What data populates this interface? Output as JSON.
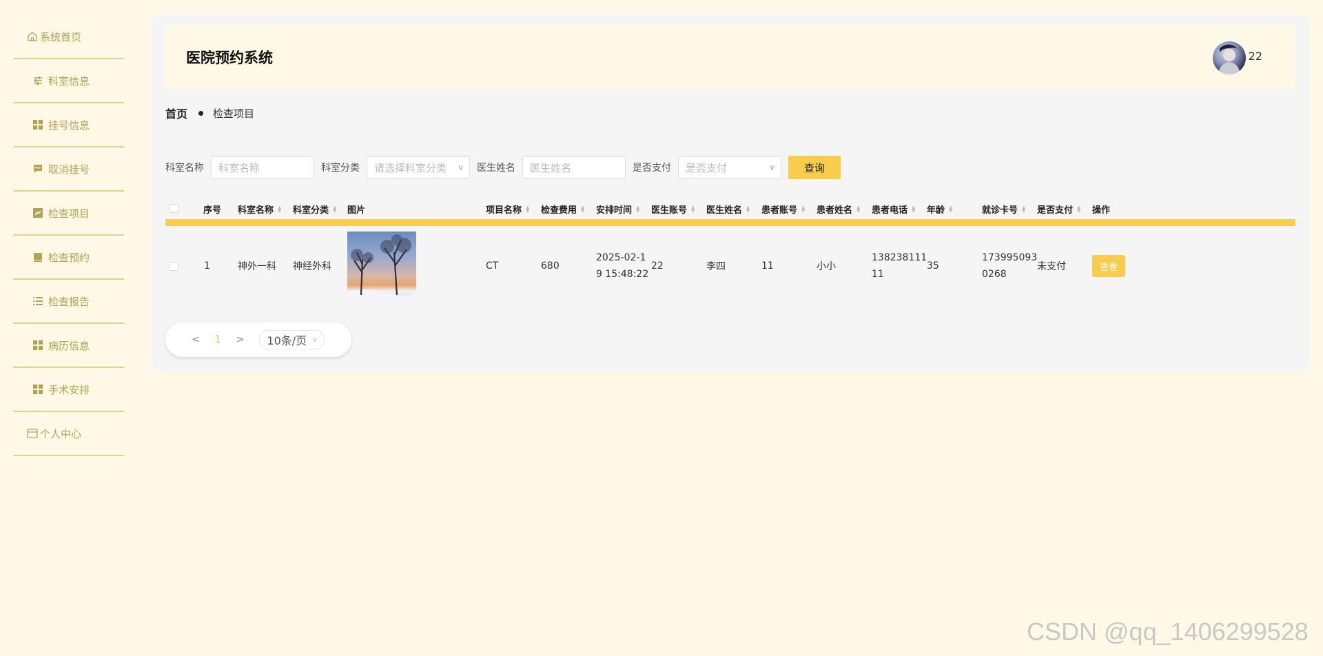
{
  "sidebar": {
    "items": [
      {
        "label": "系统首页",
        "icon": "home-icon"
      },
      {
        "label": "科室信息",
        "icon": "sliders-icon"
      },
      {
        "label": "挂号信息",
        "icon": "grid-icon"
      },
      {
        "label": "取消挂号",
        "icon": "message-icon"
      },
      {
        "label": "检查项目",
        "icon": "chart-icon"
      },
      {
        "label": "检查预约",
        "icon": "calendar-icon"
      },
      {
        "label": "检查报告",
        "icon": "list-icon"
      },
      {
        "label": "病历信息",
        "icon": "grid-icon"
      },
      {
        "label": "手术安排",
        "icon": "grid-icon"
      },
      {
        "label": "个人中心",
        "icon": "card-icon"
      }
    ]
  },
  "header": {
    "title": "医院预约系统",
    "username": "22"
  },
  "breadcrumb": {
    "home": "首页",
    "current": "检查项目"
  },
  "search": {
    "dept_name_label": "科室名称",
    "dept_name_placeholder": "科室名称",
    "dept_type_label": "科室分类",
    "dept_type_placeholder": "请选择科室分类",
    "doctor_name_label": "医生姓名",
    "doctor_name_placeholder": "医生姓名",
    "paid_label": "是否支付",
    "paid_placeholder": "是否支付",
    "query_button": "查询"
  },
  "table": {
    "headers": {
      "index": "序号",
      "dept_name": "科室名称",
      "dept_type": "科室分类",
      "image": "图片",
      "item_name": "项目名称",
      "fee": "检查费用",
      "schedule_time": "安排时间",
      "doctor_account": "医生账号",
      "doctor_name": "医生姓名",
      "patient_account": "患者账号",
      "patient_name": "患者姓名",
      "patient_phone": "患者电话",
      "age": "年龄",
      "card_no": "就诊卡号",
      "paid": "是否支付",
      "action": "操作"
    },
    "rows": [
      {
        "index": "1",
        "dept_name": "神外一科",
        "dept_type": "神经外科",
        "item_name": "CT",
        "fee": "680",
        "schedule_time_1": "2025-02-1",
        "schedule_time_2": "9 15:48:22",
        "doctor_account": "22",
        "doctor_name": "李四",
        "patient_account": "11",
        "patient_name": "小小",
        "patient_phone_1": "138238111",
        "patient_phone_2": "11",
        "age": "35",
        "card_no_1": "173995093",
        "card_no_2": "0268",
        "paid": "未支付",
        "action": "查看"
      }
    ]
  },
  "pagination": {
    "prev": "<",
    "current": "1",
    "next": ">",
    "page_size": "10条/页"
  },
  "watermark": "CSDN @qq_1406299528"
}
